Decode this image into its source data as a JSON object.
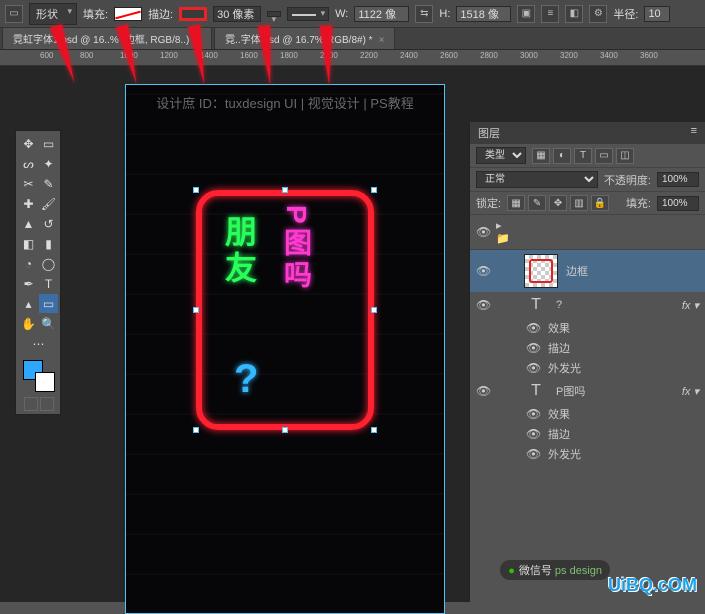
{
  "topbar": {
    "shape_mode": "形状",
    "fill_label": "填充:",
    "stroke_label": "描边:",
    "stroke_px": "30 像素",
    "w_label": "W:",
    "w_value": "1122 像",
    "h_label": "H:",
    "h_value": "1518 像",
    "radius_label": "半径:",
    "radius_value": "10"
  },
  "tabs": [
    {
      "title": "霓虹字体1.psd @ 16..% (边框, RGB/8..)"
    },
    {
      "title": "霓..字体.psd @ 16.7%(RGB/8#) *"
    }
  ],
  "ruler": [
    "600",
    "800",
    "1000",
    "1200",
    "1400",
    "1600",
    "1800",
    "2000",
    "2200",
    "2400",
    "2600",
    "2800",
    "3000",
    "3200",
    "3400",
    "3600"
  ],
  "canvas": {
    "watermark": "设计庶  ID：tuxdesign      UI | 视觉设计 | PS教程",
    "text1": "朋友",
    "text2": "P图吗",
    "text3": "?"
  },
  "layers_panel": {
    "title": "图层",
    "kind_label": "类型",
    "blend_mode": "正常",
    "opacity_label": "不透明度:",
    "opacity_value": "100%",
    "lock_label": "锁定:",
    "fill_label": "填充:",
    "fill_value": "100%",
    "items": [
      {
        "name": "边框",
        "type": "shape"
      },
      {
        "name": "?",
        "type": "text",
        "fx": [
          "效果",
          "描边",
          "外发光"
        ]
      },
      {
        "name": "P图吗",
        "type": "text",
        "fx": [
          "效果",
          "描边",
          "外发光"
        ]
      }
    ]
  },
  "footer": {
    "wechat": "微信号",
    "site": "UiBQ.cOM",
    "brand": "ps design"
  }
}
